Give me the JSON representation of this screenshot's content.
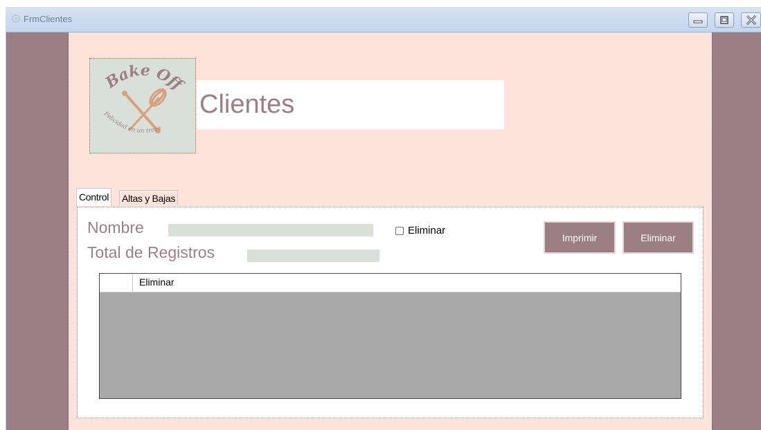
{
  "window": {
    "title": "FrmClientes",
    "controls": {
      "minimize": "minimize",
      "maximize": "maximize",
      "close": "close"
    }
  },
  "header": {
    "logo": {
      "brand": "Bake Off",
      "tagline": "Felicidad en un trozo"
    },
    "title": "Clientes"
  },
  "tabs": [
    {
      "label": "Control",
      "active": true
    },
    {
      "label": "Altas y Bajas",
      "active": false
    }
  ],
  "form": {
    "nombre_label": "Nombre",
    "nombre_value": "",
    "total_label": "Total de Registros",
    "total_value": "",
    "eliminar_checkbox_label": "Eliminar",
    "eliminar_checked": false,
    "print_button": "Imprimir",
    "delete_button": "Eliminar"
  },
  "grid": {
    "columns": [
      "Eliminar"
    ],
    "rows": []
  },
  "colors": {
    "accent": "#9b7f84",
    "background": "#fde3da",
    "field": "#d8e0d9",
    "grid_empty": "#a8a8a8"
  }
}
